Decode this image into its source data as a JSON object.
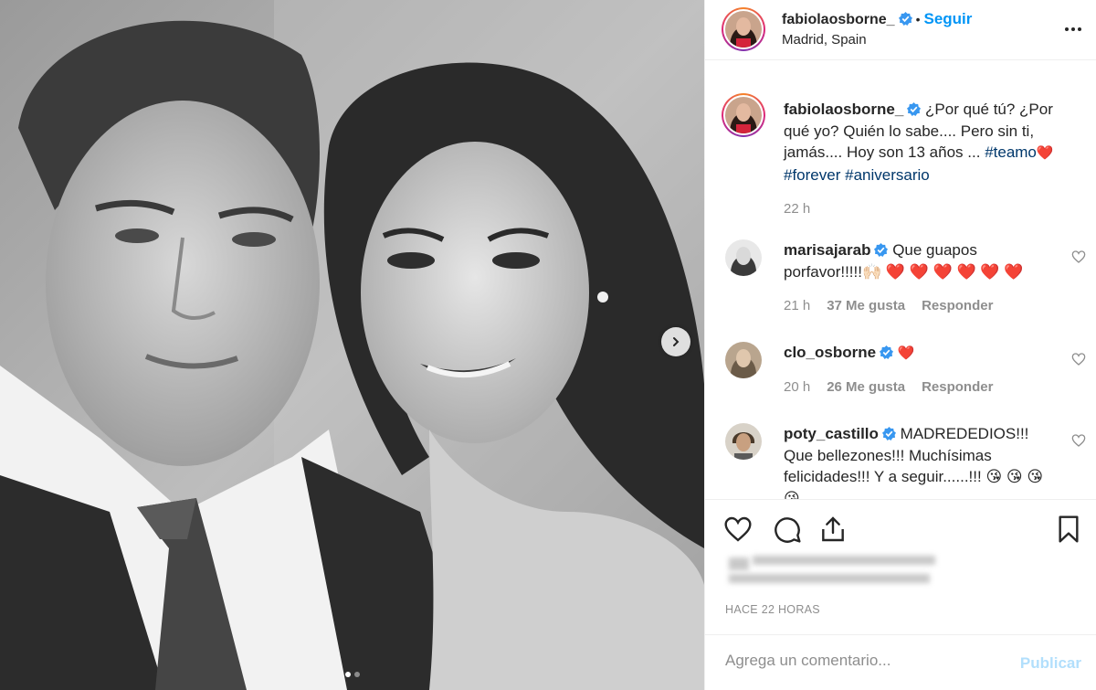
{
  "post": {
    "username": "fabiolaosborne_",
    "separator": "•",
    "follow_label": "Seguir",
    "location": "Madrid, Spain",
    "carousel": {
      "total": 2,
      "current": 1
    }
  },
  "caption": {
    "username": "fabiolaosborne_",
    "text": "¿Por qué tú? ¿Por qué yo? Quién lo sabe.... Pero sin ti, jamás.... Hoy son 13 años ...",
    "hashtag1": "#teamo",
    "heart": "❤️",
    "hashtag2": "#forever",
    "hashtag3": "#aniversario",
    "time": "22 h"
  },
  "comments": [
    {
      "username": "marisajarab",
      "text": "Que guapos porfavor!!!!!🙌🏻 ❤️ ❤️ ❤️ ❤️ ❤️ ❤️",
      "time": "21 h",
      "likes": "37 Me gusta",
      "reply": "Responder"
    },
    {
      "username": "clo_osborne",
      "text": "❤️",
      "time": "20 h",
      "likes": "26 Me gusta",
      "reply": "Responder"
    },
    {
      "username": "poty_castillo",
      "text": "MADREDEDIOS!!! Que bellezones!!! Muchísimas felicidades!!! Y a seguir......!!! 😘 😘 😘 😘",
      "time": "",
      "likes": "",
      "reply": ""
    }
  ],
  "footer": {
    "timestamp": "HACE 22 HORAS",
    "comment_placeholder": "Agrega un comentario...",
    "publish_label": "Publicar"
  },
  "colors": {
    "link": "#0095f6",
    "hashtag": "#00376b",
    "muted": "#8e8e8e",
    "heart": "#ed4956"
  },
  "icons": [
    "verified-badge-icon",
    "more-options-icon",
    "chevron-right-icon",
    "heart-icon",
    "comment-icon",
    "share-icon",
    "bookmark-icon"
  ]
}
